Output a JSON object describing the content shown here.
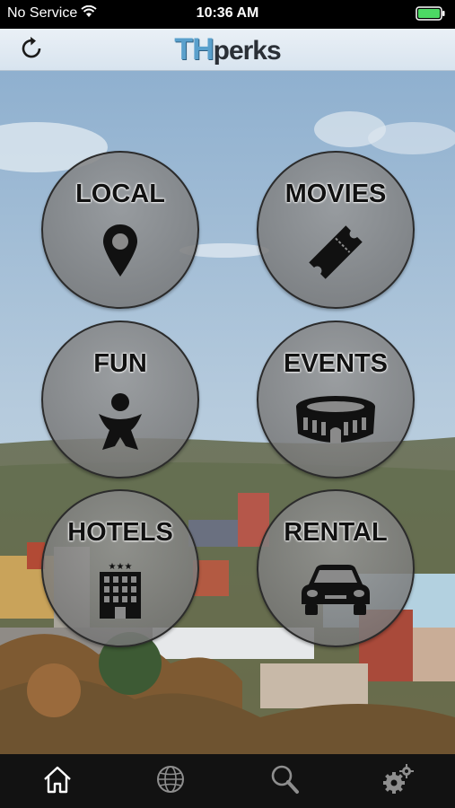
{
  "status_bar": {
    "carrier": "No Service",
    "time": "10:36 AM",
    "battery_icon": "battery-full-icon",
    "wifi_icon": "wifi-icon"
  },
  "header": {
    "refresh_icon": "refresh-icon",
    "logo_th": "TH",
    "logo_perks": "perks"
  },
  "menu": [
    {
      "label": "LOCAL",
      "icon": "map-pin-icon"
    },
    {
      "label": "MOVIES",
      "icon": "ticket-icon"
    },
    {
      "label": "FUN",
      "icon": "person-icon"
    },
    {
      "label": "EVENTS",
      "icon": "stadium-icon"
    },
    {
      "label": "HOTELS",
      "icon": "hotel-icon"
    },
    {
      "label": "RENTAL",
      "icon": "car-icon"
    }
  ],
  "tabs": [
    {
      "icon": "home-icon",
      "active": true
    },
    {
      "icon": "globe-icon",
      "active": false
    },
    {
      "icon": "search-icon",
      "active": false
    },
    {
      "icon": "gear-icon",
      "active": false
    }
  ],
  "colors": {
    "logo_accent": "#5aa0cc",
    "tabbar_bg": "#121212",
    "circle_fill": "#8a8a8a"
  }
}
